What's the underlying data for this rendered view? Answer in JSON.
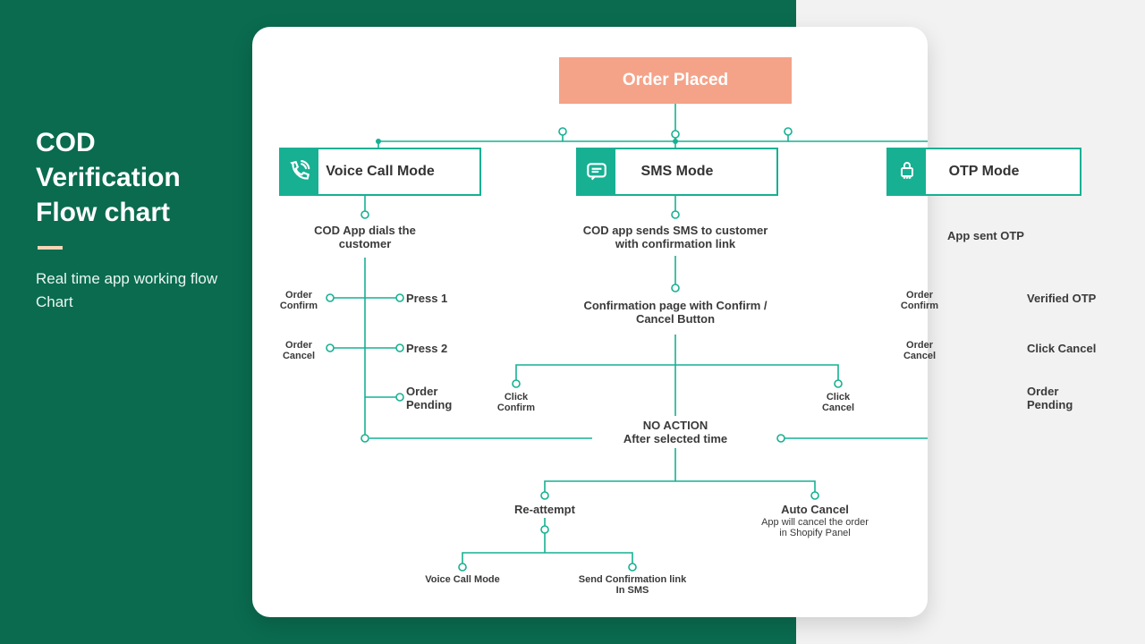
{
  "sidebar": {
    "title_l1": "COD",
    "title_l2": "Verification",
    "title_l3": "Flow chart",
    "subtitle": "Real time app working flow Chart"
  },
  "top": {
    "order_placed": "Order Placed"
  },
  "modes": {
    "voice": "Voice Call Mode",
    "sms": "SMS Mode",
    "otp": "OTP Mode"
  },
  "voice_branch": {
    "desc": "COD App dials the customer",
    "confirm_left": "Order Confirm",
    "confirm_right": "Press 1",
    "cancel_left": "Order Cancel",
    "cancel_right": "Press 2",
    "pending": "Order Pending"
  },
  "sms_branch": {
    "desc": "COD app sends SMS to customer with confirmation link",
    "page": "Confirmation page with Confirm / Cancel Button",
    "click_confirm": "Click Confirm",
    "click_cancel": "Click Cancel",
    "noaction_l1": "NO ACTION",
    "noaction_l2": "After selected time",
    "reattempt": "Re-attempt",
    "auto_cancel": "Auto Cancel",
    "auto_cancel_desc": "App will cancel the order in Shopify Panel",
    "re_voice": "Voice Call Mode",
    "re_sms": "Send Confirmation link In SMS"
  },
  "otp_branch": {
    "desc": "App sent OTP",
    "confirm_left": "Order Confirm",
    "confirm_right": "Verified OTP",
    "cancel_left": "Order Cancel",
    "cancel_right": "Click Cancel",
    "pending": "Order Pending"
  }
}
